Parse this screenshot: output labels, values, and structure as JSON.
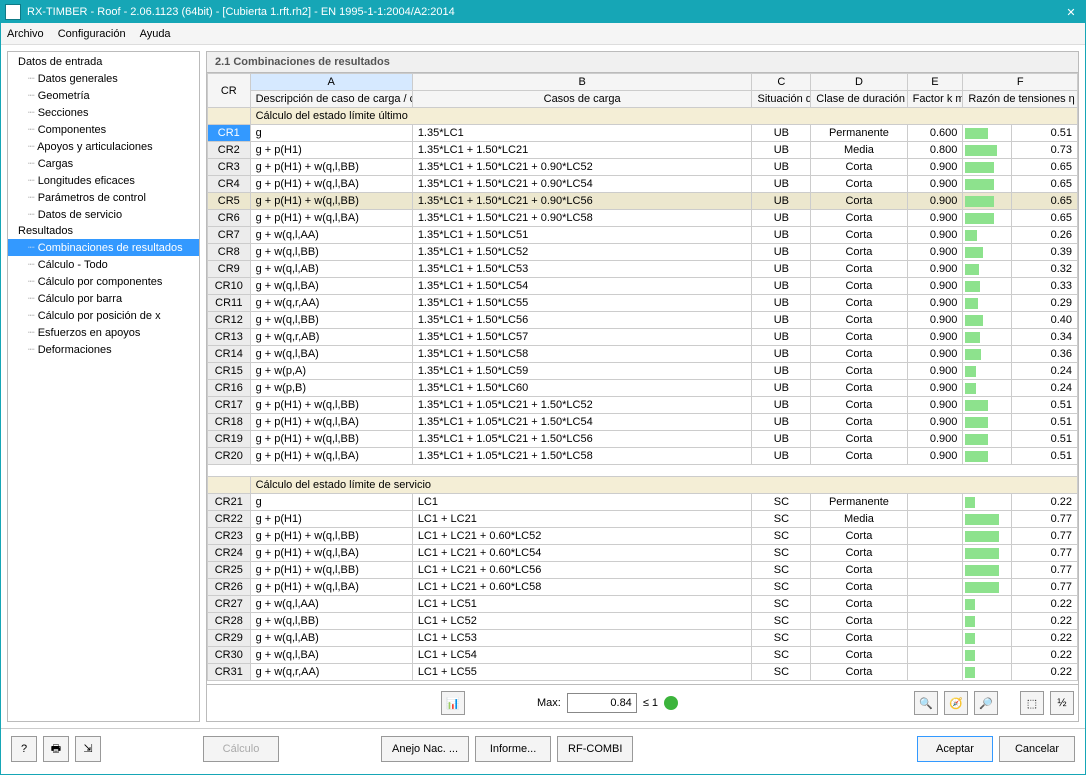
{
  "title": "RX-TIMBER - Roof - 2.06.1123 (64bit) - [Cubierta 1.rft.rh2] - EN 1995-1-1:2004/A2:2014",
  "menu": {
    "file": "Archivo",
    "config": "Configuración",
    "help": "Ayuda"
  },
  "nav": {
    "input_header": "Datos de entrada",
    "input_items": [
      "Datos generales",
      "Geometría",
      "Secciones",
      "Componentes",
      "Apoyos y articulaciones",
      "Cargas",
      "Longitudes eficaces",
      "Parámetros de control",
      "Datos de servicio"
    ],
    "results_header": "Resultados",
    "results_items": [
      "Combinaciones de resultados",
      "Cálculo - Todo",
      "Cálculo por componentes",
      "Cálculo por barra",
      "Cálculo por posición de x",
      "Esfuerzos en apoyos",
      "Deformaciones"
    ],
    "selected": "Combinaciones de resultados"
  },
  "panel_title": "2.1 Combinaciones de resultados",
  "col_letters": {
    "a": "A",
    "b": "B",
    "c": "C",
    "d": "D",
    "e": "E",
    "f": "F"
  },
  "columns": {
    "cr": "CR",
    "a": "Descripción de caso de carga / combinación de resultados",
    "b": "Casos de carga",
    "c": "Situación de cálculo",
    "d": "Clase de duración de carga (CDC)",
    "e": "Factor k mod",
    "f": "Razón de tensiones η max"
  },
  "section1": "Cálculo del estado límite último",
  "section2": "Cálculo del estado límite de servicio",
  "rows1": [
    {
      "cr": "CR1",
      "a": "g",
      "b": "1.35*LC1",
      "c": "UB",
      "d": "Permanente",
      "e": "0.600",
      "f": 0.51,
      "sel": true
    },
    {
      "cr": "CR2",
      "a": "g + p(H1)",
      "b": "1.35*LC1 + 1.50*LC21",
      "c": "UB",
      "d": "Media",
      "e": "0.800",
      "f": 0.73
    },
    {
      "cr": "CR3",
      "a": "g + p(H1) + w(q,l,BB)",
      "b": "1.35*LC1 + 1.50*LC21 + 0.90*LC52",
      "c": "UB",
      "d": "Corta",
      "e": "0.900",
      "f": 0.65
    },
    {
      "cr": "CR4",
      "a": "g + p(H1) + w(q,l,BA)",
      "b": "1.35*LC1 + 1.50*LC21 + 0.90*LC54",
      "c": "UB",
      "d": "Corta",
      "e": "0.900",
      "f": 0.65
    },
    {
      "cr": "CR5",
      "a": "g + p(H1) + w(q,l,BB)",
      "b": "1.35*LC1 + 1.50*LC21 + 0.90*LC56",
      "c": "UB",
      "d": "Corta",
      "e": "0.900",
      "f": 0.65,
      "hi": true
    },
    {
      "cr": "CR6",
      "a": "g + p(H1) + w(q,l,BA)",
      "b": "1.35*LC1 + 1.50*LC21 + 0.90*LC58",
      "c": "UB",
      "d": "Corta",
      "e": "0.900",
      "f": 0.65
    },
    {
      "cr": "CR7",
      "a": "g + w(q,l,AA)",
      "b": "1.35*LC1 + 1.50*LC51",
      "c": "UB",
      "d": "Corta",
      "e": "0.900",
      "f": 0.26
    },
    {
      "cr": "CR8",
      "a": "g + w(q,l,BB)",
      "b": "1.35*LC1 + 1.50*LC52",
      "c": "UB",
      "d": "Corta",
      "e": "0.900",
      "f": 0.39
    },
    {
      "cr": "CR9",
      "a": "g + w(q,l,AB)",
      "b": "1.35*LC1 + 1.50*LC53",
      "c": "UB",
      "d": "Corta",
      "e": "0.900",
      "f": 0.32
    },
    {
      "cr": "CR10",
      "a": "g + w(q,l,BA)",
      "b": "1.35*LC1 + 1.50*LC54",
      "c": "UB",
      "d": "Corta",
      "e": "0.900",
      "f": 0.33
    },
    {
      "cr": "CR11",
      "a": "g + w(q,r,AA)",
      "b": "1.35*LC1 + 1.50*LC55",
      "c": "UB",
      "d": "Corta",
      "e": "0.900",
      "f": 0.29
    },
    {
      "cr": "CR12",
      "a": "g + w(q,l,BB)",
      "b": "1.35*LC1 + 1.50*LC56",
      "c": "UB",
      "d": "Corta",
      "e": "0.900",
      "f": 0.4
    },
    {
      "cr": "CR13",
      "a": "g + w(q,r,AB)",
      "b": "1.35*LC1 + 1.50*LC57",
      "c": "UB",
      "d": "Corta",
      "e": "0.900",
      "f": 0.34
    },
    {
      "cr": "CR14",
      "a": "g + w(q,l,BA)",
      "b": "1.35*LC1 + 1.50*LC58",
      "c": "UB",
      "d": "Corta",
      "e": "0.900",
      "f": 0.36
    },
    {
      "cr": "CR15",
      "a": "g + w(p,A)",
      "b": "1.35*LC1 + 1.50*LC59",
      "c": "UB",
      "d": "Corta",
      "e": "0.900",
      "f": 0.24
    },
    {
      "cr": "CR16",
      "a": "g + w(p,B)",
      "b": "1.35*LC1 + 1.50*LC60",
      "c": "UB",
      "d": "Corta",
      "e": "0.900",
      "f": 0.24
    },
    {
      "cr": "CR17",
      "a": "g + p(H1) + w(q,l,BB)",
      "b": "1.35*LC1 + 1.05*LC21 + 1.50*LC52",
      "c": "UB",
      "d": "Corta",
      "e": "0.900",
      "f": 0.51
    },
    {
      "cr": "CR18",
      "a": "g + p(H1) + w(q,l,BA)",
      "b": "1.35*LC1 + 1.05*LC21 + 1.50*LC54",
      "c": "UB",
      "d": "Corta",
      "e": "0.900",
      "f": 0.51
    },
    {
      "cr": "CR19",
      "a": "g + p(H1) + w(q,l,BB)",
      "b": "1.35*LC1 + 1.05*LC21 + 1.50*LC56",
      "c": "UB",
      "d": "Corta",
      "e": "0.900",
      "f": 0.51
    },
    {
      "cr": "CR20",
      "a": "g + p(H1) + w(q,l,BA)",
      "b": "1.35*LC1 + 1.05*LC21 + 1.50*LC58",
      "c": "UB",
      "d": "Corta",
      "e": "0.900",
      "f": 0.51
    }
  ],
  "rows2": [
    {
      "cr": "CR21",
      "a": "g",
      "b": "LC1",
      "c": "SC",
      "d": "Permanente",
      "e": "",
      "f": 0.22
    },
    {
      "cr": "CR22",
      "a": "g + p(H1)",
      "b": "LC1 + LC21",
      "c": "SC",
      "d": "Media",
      "e": "",
      "f": 0.77
    },
    {
      "cr": "CR23",
      "a": "g + p(H1) + w(q,l,BB)",
      "b": "LC1 + LC21 + 0.60*LC52",
      "c": "SC",
      "d": "Corta",
      "e": "",
      "f": 0.77
    },
    {
      "cr": "CR24",
      "a": "g + p(H1) + w(q,l,BA)",
      "b": "LC1 + LC21 + 0.60*LC54",
      "c": "SC",
      "d": "Corta",
      "e": "",
      "f": 0.77
    },
    {
      "cr": "CR25",
      "a": "g + p(H1) + w(q,l,BB)",
      "b": "LC1 + LC21 + 0.60*LC56",
      "c": "SC",
      "d": "Corta",
      "e": "",
      "f": 0.77
    },
    {
      "cr": "CR26",
      "a": "g + p(H1) + w(q,l,BA)",
      "b": "LC1 + LC21 + 0.60*LC58",
      "c": "SC",
      "d": "Corta",
      "e": "",
      "f": 0.77
    },
    {
      "cr": "CR27",
      "a": "g + w(q,l,AA)",
      "b": "LC1 + LC51",
      "c": "SC",
      "d": "Corta",
      "e": "",
      "f": 0.22
    },
    {
      "cr": "CR28",
      "a": "g + w(q,l,BB)",
      "b": "LC1 + LC52",
      "c": "SC",
      "d": "Corta",
      "e": "",
      "f": 0.22
    },
    {
      "cr": "CR29",
      "a": "g + w(q,l,AB)",
      "b": "LC1 + LC53",
      "c": "SC",
      "d": "Corta",
      "e": "",
      "f": 0.22
    },
    {
      "cr": "CR30",
      "a": "g + w(q,l,BA)",
      "b": "LC1 + LC54",
      "c": "SC",
      "d": "Corta",
      "e": "",
      "f": 0.22
    },
    {
      "cr": "CR31",
      "a": "g + w(q,r,AA)",
      "b": "LC1 + LC55",
      "c": "SC",
      "d": "Corta",
      "e": "",
      "f": 0.22
    }
  ],
  "status": {
    "max_label": "Max:",
    "max_value": "0.84",
    "limit": "≤ 1"
  },
  "footer": {
    "calc": "Cálculo",
    "annex": "Anejo Nac. ...",
    "report": "Informe...",
    "rfcombi": "RF-COMBI",
    "ok": "Aceptar",
    "cancel": "Cancelar"
  }
}
